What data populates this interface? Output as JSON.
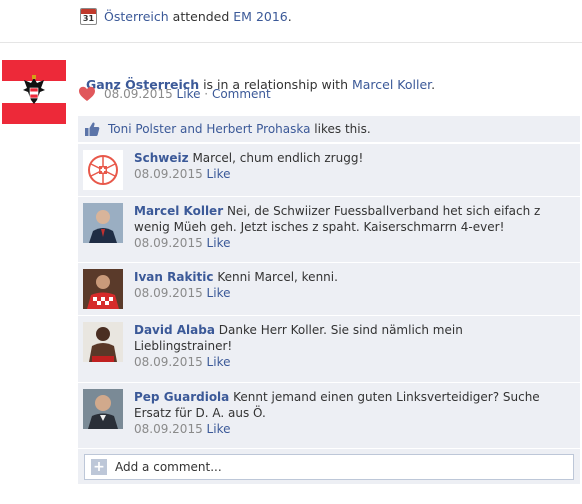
{
  "event": {
    "calendar_day": "31",
    "subject": "Österreich",
    "verb": " attended ",
    "target": "EM 2016",
    "suffix": "."
  },
  "post": {
    "author": "Ganz Österreich",
    "status_text": " is in a relationship with ",
    "partner": "Marcel Koller",
    "suffix": ".",
    "date": "08.09.2015",
    "like_label": "Like",
    "separator": " · ",
    "comment_label": "Comment"
  },
  "likes": {
    "names": "Toni Polster and Herbert Prohaska",
    "suffix": " likes this."
  },
  "comments": [
    {
      "name": "Schweiz",
      "text": "Marcel, chum endlich zrugg!",
      "date": "08.09.2015",
      "like": "Like"
    },
    {
      "name": "Marcel Koller",
      "text": "Nei, de Schwiizer Fuessballverband het sich eifach z wenig Müeh geh. Jetzt isches z spaht. Kaiserschmarrn 4-ever!",
      "date": "08.09.2015",
      "like": "Like"
    },
    {
      "name": "Ivan Rakitic",
      "text": "Kenni Marcel, kenni.",
      "date": "08.09.2015",
      "like": "Like"
    },
    {
      "name": "David Alaba",
      "text": "Danke Herr Koller. Sie sind nämlich mein Lieblingstrainer!",
      "date": "08.09.2015",
      "like": "Like"
    },
    {
      "name": "Pep Guardiola",
      "text": "Kennt jemand einen guten Linksverteidiger? Suche Ersatz für D. A. aus Ö.",
      "date": "08.09.2015",
      "like": "Like"
    }
  ],
  "add_comment": {
    "placeholder": "Add a comment..."
  },
  "colors": {
    "link": "#3b5998",
    "panel": "#edeff4",
    "flag_red": "#ed2939",
    "meta": "#8a8a8a"
  }
}
